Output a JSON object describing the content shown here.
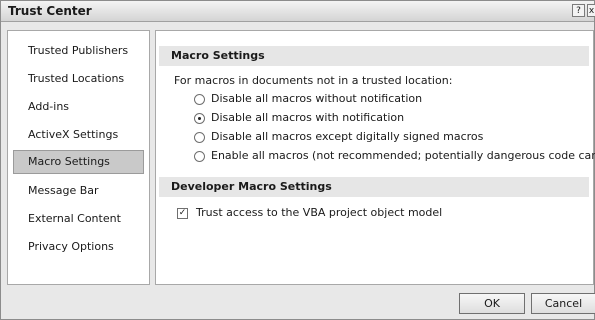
{
  "window": {
    "title": "Trust Center",
    "help_glyph": "?",
    "close_glyph": "x"
  },
  "sidebar": {
    "items": [
      {
        "label": "Trusted Publishers"
      },
      {
        "label": "Trusted Locations"
      },
      {
        "label": "Add-ins"
      },
      {
        "label": "ActiveX Settings"
      },
      {
        "label": "Macro Settings",
        "selected": true
      },
      {
        "label": "Message Bar"
      },
      {
        "label": "External Content"
      },
      {
        "label": "Privacy Options"
      }
    ]
  },
  "macro": {
    "heading": "Macro Settings",
    "prompt": "For macros in documents not in a trusted location:",
    "options": [
      {
        "label": "Disable all macros without notification",
        "checked": false
      },
      {
        "label": "Disable all macros with notification",
        "checked": true
      },
      {
        "label": "Disable all macros except digitally signed macros",
        "checked": false
      },
      {
        "label": "Enable all macros (not recommended; potentially dangerous code can run)",
        "checked": false
      }
    ]
  },
  "developer": {
    "heading": "Developer Macro Settings",
    "checkbox_label": "Trust access to the VBA project object model",
    "checked": true
  },
  "buttons": {
    "ok": "OK",
    "cancel": "Cancel"
  }
}
